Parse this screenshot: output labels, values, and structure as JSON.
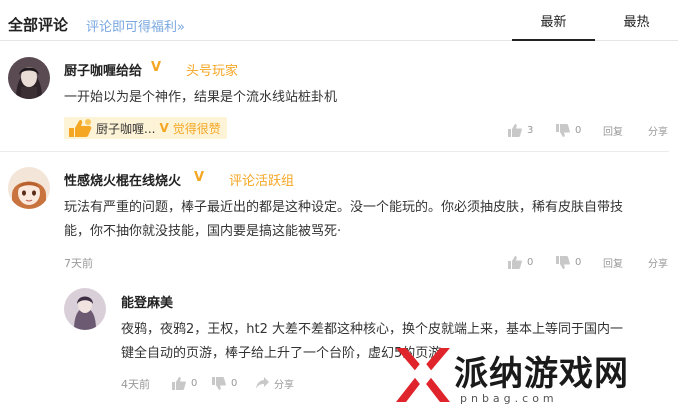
{
  "header": {
    "title": "全部评论",
    "promo_link": "评论即可得福利»",
    "sort_tabs": [
      "最新",
      "最热"
    ]
  },
  "comments": [
    {
      "username": "厨子咖喱给给",
      "verified": "V",
      "level": "头号玩家",
      "content": "一开始以为是个神作，结果是个流水线站桩卦机",
      "liked_by": {
        "name": "厨子咖喱...",
        "verified": "V",
        "text": "觉得很赞"
      },
      "likes": "3",
      "dislikes": "0",
      "reply_label": "回复",
      "share_label": "分享"
    },
    {
      "username": "性感烧火棍在线烧火",
      "verified": "V",
      "level": "评论活跃组",
      "content_lines": [
        "玩法有严重的问题，棒子最近出的都是这种设定。没一个能玩的。你必须抽皮肤，稀有皮肤自带技",
        "能，你不抽你就没技能，国内要是搞这能被骂死·"
      ],
      "time": "7天前",
      "likes": "0",
      "dislikes": "0",
      "reply_label": "回复",
      "share_label": "分享"
    }
  ],
  "reply": {
    "username": "能登麻美",
    "content_lines": [
      "夜鸦，夜鸦2，王权，ht2  大差不差都这种核心，换个皮就端上来，基本上等同于国内一",
      "键全自动的页游，棒子给上升了一个台阶，虚幻5的页游"
    ],
    "time": "4天前",
    "likes": "0",
    "dislikes": "0",
    "share_label": "分享"
  },
  "watermark": {
    "text": "派纳游戏网",
    "url": "pnbag.com"
  },
  "colors": {
    "accent_gold": "#f5a623",
    "link_blue": "#7aa7e0",
    "muted": "#999999",
    "liked_bg": "#fdf3d6",
    "watermark_red": "#e0242b"
  },
  "icons": [
    "thumbs-up-icon",
    "thumbs-down-icon",
    "avatar",
    "watermark-logo-icon"
  ]
}
